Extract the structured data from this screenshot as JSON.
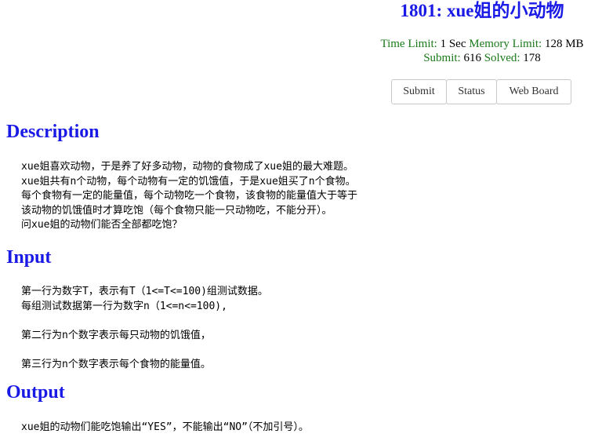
{
  "problem": {
    "title": "1801: xue姐的小动物",
    "time_limit_label": "Time Limit:",
    "time_limit_value": "1 Sec",
    "memory_limit_label": "Memory Limit:",
    "memory_limit_value": "128 MB",
    "submit_label": "Submit:",
    "submit_value": "616",
    "solved_label": "Solved:",
    "solved_value": "178"
  },
  "buttons": {
    "submit": "Submit",
    "status": "Status",
    "web_board": "Web Board"
  },
  "sections": {
    "description": {
      "heading": "Description",
      "lines": [
        "xue姐喜欢动物，于是养了好多动物，动物的食物成了xue姐的最大难题。",
        "xue姐共有n个动物，每个动物有一定的饥饿值，于是xue姐买了n个食物。",
        "每个食物有一定的能量值，每个动物吃一个食物，该食物的能量值大于等于",
        "该动物的饥饿值时才算吃饱（每个食物只能一只动物吃，不能分开）。",
        "问xue姐的动物们能否全部都吃饱？"
      ]
    },
    "input": {
      "heading": "Input",
      "lines": [
        "第一行为数字T，表示有T（1<=T<=100)组测试数据。",
        "每组测试数据第一行为数字n（1<=n<=100),",
        "",
        "第二行为n个数字表示每只动物的饥饿值，",
        "",
        "第三行为n个数字表示每个食物的能量值。"
      ]
    },
    "output": {
      "heading": "Output",
      "lines": [
        "xue姐的动物们能吃饱输出“YES”，不能输出“NO”（不加引号）。"
      ]
    }
  },
  "colors": {
    "heading": "#1a1ae6",
    "label_green": "#1a7a1a"
  }
}
